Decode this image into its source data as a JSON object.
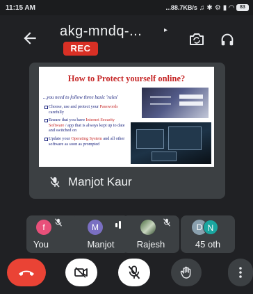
{
  "status_bar": {
    "time": "11:15 AM",
    "network": "...88.7KB/s",
    "battery": "83"
  },
  "header": {
    "title": "akg-mndq-...",
    "rec_label": "REC"
  },
  "main_tile": {
    "presenter_name": "Manjot Kaur",
    "slide": {
      "title": "How to Protect yourself online?",
      "subtitle": "...you need to follow three basic 'rules'",
      "bullets": [
        {
          "pre": "Choose, use and protect your ",
          "hl": "Passwords",
          "post": " carefully"
        },
        {
          "pre": "Ensure that you have ",
          "hl": "Internet Security Software",
          "post": " / app that is always kept up to date and switched on"
        },
        {
          "pre": "Update your ",
          "hl": "Operating System",
          "post": " and all other software as soon as prompted"
        }
      ]
    }
  },
  "participants": [
    {
      "initial": "f",
      "name": "You",
      "color": "#e8507a",
      "muted": true
    },
    {
      "initial": "M",
      "name": "Manjot",
      "color": "#7a6fc2",
      "muted": false,
      "speaking": true
    },
    {
      "name": "Rajesh",
      "muted": true,
      "photo": true
    },
    {
      "initials": [
        "D",
        "N"
      ],
      "colors": [
        "#8aa0ae",
        "#1aa6a0"
      ],
      "name": "45 oth"
    }
  ],
  "colors": {
    "background": "#202124",
    "tile": "#3c4043",
    "rec": "#d93025",
    "end_call": "#ea4335"
  }
}
